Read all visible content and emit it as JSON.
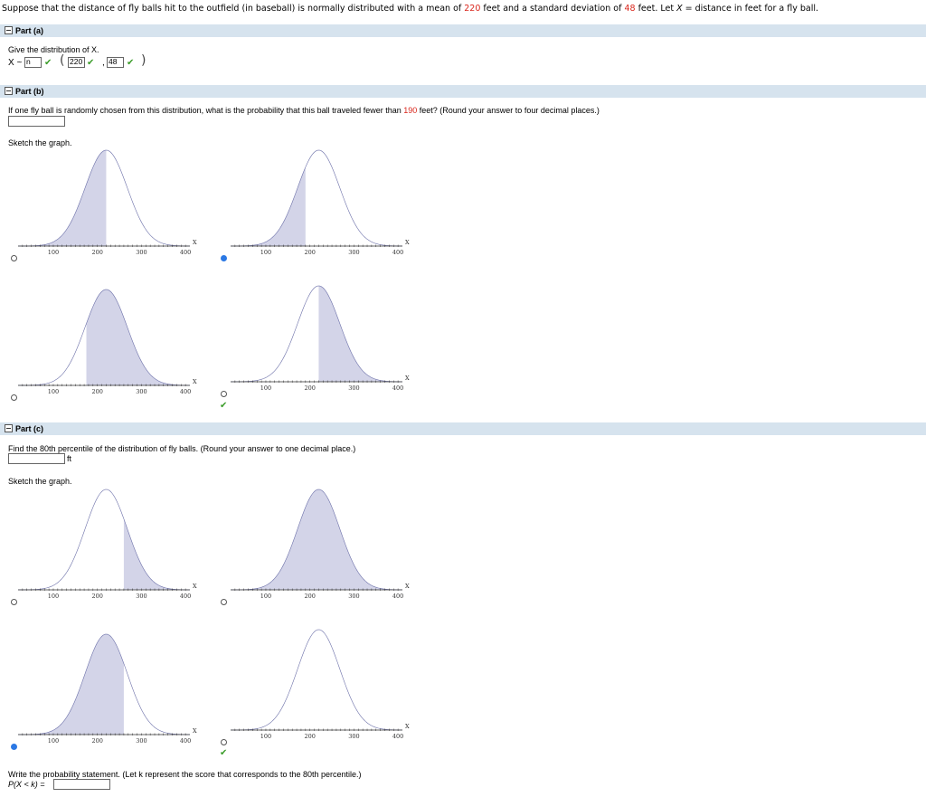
{
  "problem": {
    "text_1": "Suppose that the distance of fly balls hit to the outfield (in baseball) is normally distributed with a mean of ",
    "mean": "220",
    "text_2": " feet and a standard deviation of ",
    "sd": "48",
    "text_3": " feet. Let ",
    "var": "X",
    "text_4": " = distance in feet for a fly ball."
  },
  "part_a": {
    "header": "Part (a)",
    "prompt": "Give the distribution of X.",
    "x_label": "X ~",
    "dist_value": "n",
    "mean_value": "220",
    "sd_value": "48"
  },
  "part_b": {
    "header": "Part (b)",
    "q_1": "If one fly ball is randomly chosen from this distribution, what is the probability that this ball traveled fewer than ",
    "q_val": "190",
    "q_2": " feet? (Round your answer to four decimal places.)",
    "answer": "",
    "sketch_label": "Sketch the graph."
  },
  "part_c": {
    "header": "Part (c)",
    "question": "Find the 80th percentile of the distribution of fly balls. (Round your answer to one decimal place.)",
    "answer": "",
    "unit": "ft",
    "sketch_label": "Sketch the graph.",
    "statement_prompt": "Write the probability statement. (Let k represent the score that corresponds to the 80th percentile.)",
    "statement_label": "P(X < k) =",
    "statement_answer": ""
  },
  "axis": {
    "ticks": [
      "100",
      "200",
      "300",
      "400"
    ],
    "var_label": "X"
  },
  "graphs_b": [
    {
      "shade": "left",
      "cut": 220,
      "selected": false,
      "correct": false
    },
    {
      "shade": "left",
      "cut": 190,
      "selected": true,
      "correct": false
    },
    {
      "shade": "right",
      "cut": 175,
      "selected": false,
      "correct": false
    },
    {
      "shade": "right",
      "cut": 220,
      "selected": false,
      "correct": true
    }
  ],
  "graphs_c": [
    {
      "shade": "right",
      "cut": 260,
      "selected": false,
      "correct": false
    },
    {
      "shade": "all",
      "cut": null,
      "selected": false,
      "correct": false
    },
    {
      "shade": "left",
      "cut": 260,
      "selected": true,
      "correct": false
    },
    {
      "shade": "none",
      "cut": null,
      "selected": false,
      "correct": true
    }
  ],
  "colors": {
    "shade": "#d3d4e8",
    "curve": "#6b6fa8",
    "header": "#d6e3ee",
    "highlight": "#d9261c",
    "check": "#3c9d2b",
    "radio_selected": "#2b78e4"
  }
}
